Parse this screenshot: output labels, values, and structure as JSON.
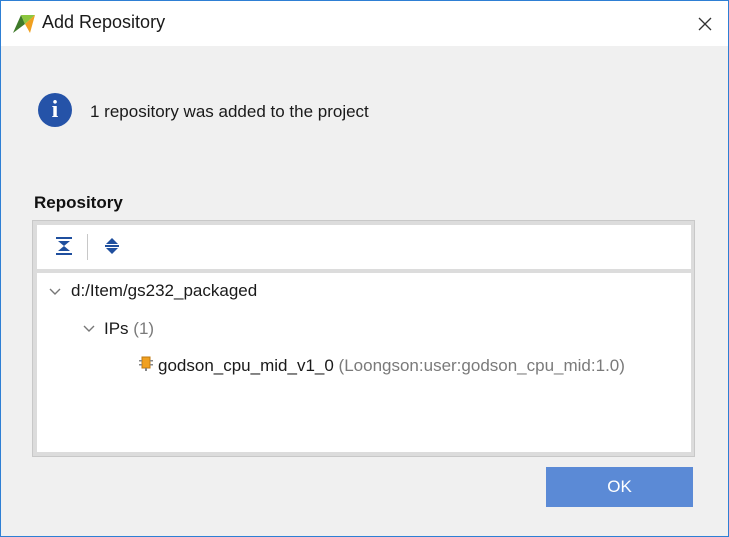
{
  "window": {
    "title": "Add Repository"
  },
  "message": {
    "text": "1 repository was added to the project"
  },
  "repository": {
    "heading": "Repository",
    "toolbar": {
      "collapse_all_icon": "collapse-all-icon",
      "expand_all_icon": "expand-all-icon"
    },
    "tree": {
      "root": {
        "label": "d:/Item/gs232_packaged"
      },
      "group": {
        "label": "IPs",
        "count": "(1)"
      },
      "item": {
        "name": "godson_cpu_mid_v1_0",
        "vlnv": "(Loongson:user:godson_cpu_mid:1.0)"
      }
    }
  },
  "buttons": {
    "ok": "OK"
  },
  "colors": {
    "title_border": "#2e7fd4",
    "info_icon": "#2553a8",
    "ok_button": "#5b8ad6",
    "ip_icon": "#f0a020",
    "toolbar_icon": "#1f4f9e"
  }
}
